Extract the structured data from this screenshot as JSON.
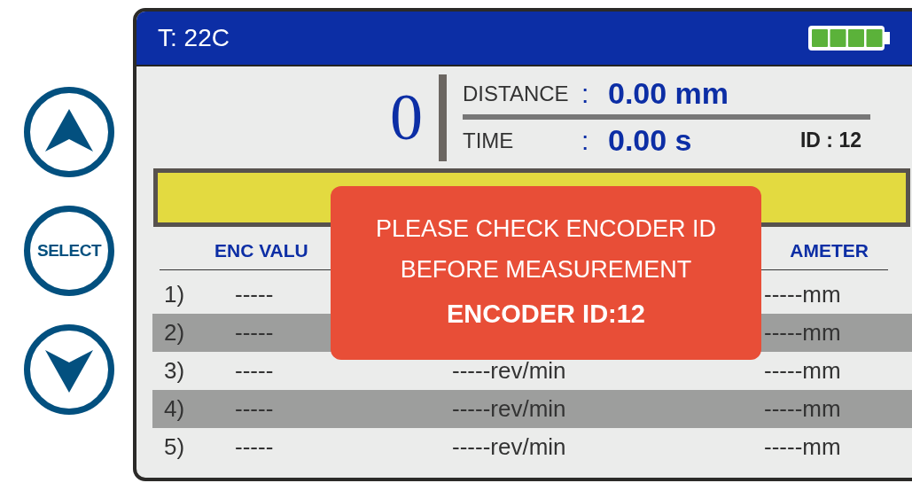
{
  "status_bar": {
    "temperature": "T: 22C"
  },
  "side_buttons": [
    {
      "kind": "up"
    },
    {
      "kind": "select",
      "label": "SELECT"
    },
    {
      "kind": "down"
    }
  ],
  "readout": {
    "count": "0",
    "distance": {
      "label": "DISTANCE",
      "separator": ":",
      "value": "0.00 mm"
    },
    "time": {
      "label": "TIME",
      "separator": ":",
      "value": "0.00 s"
    },
    "id": "ID : 12"
  },
  "table": {
    "columns": [
      {
        "label": "ENC VALU"
      },
      {
        "label": "AMETER"
      }
    ],
    "rows": [
      {
        "number": "1)",
        "enc": "-----",
        "diameter": "-----mm"
      },
      {
        "number": "2)",
        "enc": "-----",
        "diameter": "-----mm"
      },
      {
        "number": "3)",
        "enc": "-----",
        "speed": "-----rev/min",
        "diameter": "-----mm"
      },
      {
        "number": "4)",
        "enc": "-----",
        "speed": "-----rev/min",
        "diameter": "-----mm"
      },
      {
        "number": "5)",
        "enc": "-----",
        "speed": "-----rev/min",
        "diameter": "-----mm"
      }
    ]
  },
  "alert": {
    "lines": [
      "PLEASE CHECK ENCODER ID",
      "BEFORE MEASUREMENT"
    ],
    "emphasis": "ENCODER ID:12"
  }
}
